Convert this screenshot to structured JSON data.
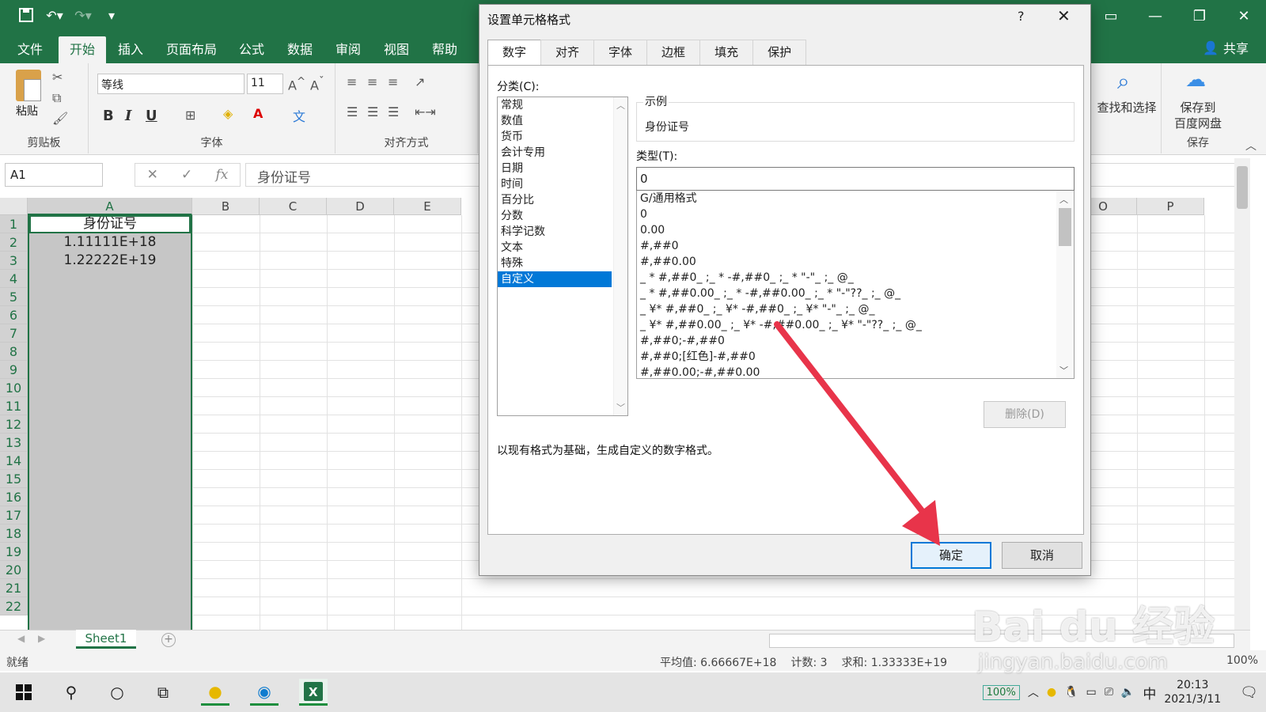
{
  "titlebar": {
    "qat": [
      "save-icon",
      "undo-icon",
      "redo-icon",
      "customize-icon"
    ],
    "accent": "#217346"
  },
  "ribbon_tabs": [
    "文件",
    "开始",
    "插入",
    "页面布局",
    "公式",
    "数据",
    "审阅",
    "视图",
    "帮助"
  ],
  "active_tab": "开始",
  "share_label": "共享",
  "ribbon": {
    "paste_label": "粘贴",
    "clipboard_label": "剪贴板",
    "font_name": "等线",
    "font_size": "11",
    "font_group_label": "字体",
    "align_group_label": "对齐方式",
    "bold": "B",
    "italic": "I",
    "underline": "U",
    "find_label": "查找和选择",
    "save_baidu_label_1": "保存到",
    "save_baidu_label_2": "百度网盘",
    "save_group_label": "保存"
  },
  "formula_bar": {
    "name_box": "A1",
    "fx": "fx",
    "content": "身份证号"
  },
  "grid": {
    "columns": [
      "A",
      "B",
      "C",
      "D",
      "E",
      "O",
      "P"
    ],
    "rows": [
      "1",
      "2",
      "3",
      "4",
      "5",
      "6",
      "7",
      "8",
      "9",
      "10",
      "11",
      "12",
      "13",
      "14",
      "15",
      "16",
      "17",
      "18",
      "19",
      "20",
      "21",
      "22"
    ],
    "cells_A": [
      "身份证号",
      "1.11111E+18",
      "1.22222E+19"
    ]
  },
  "sheet_tab": "Sheet1",
  "status": {
    "ready": "就绪",
    "average": "平均值: 6.66667E+18",
    "count": "计数: 3",
    "sum": "求和: 1.33333E+19",
    "zoom": "100%"
  },
  "dialog": {
    "title": "设置单元格格式",
    "help": "?",
    "close": "✕",
    "tabs": [
      "数字",
      "对齐",
      "字体",
      "边框",
      "填充",
      "保护"
    ],
    "active_tab": "数字",
    "category_label": "分类(C):",
    "categories": [
      "常规",
      "数值",
      "货币",
      "会计专用",
      "日期",
      "时间",
      "百分比",
      "分数",
      "科学记数",
      "文本",
      "特殊",
      "自定义"
    ],
    "selected_category": "自定义",
    "sample_label": "示例",
    "sample_value": "身份证号",
    "type_label": "类型(T):",
    "type_value": "0",
    "formats": [
      "G/通用格式",
      "0",
      "0.00",
      "#,##0",
      "#,##0.00",
      "_ * #,##0_ ;_ * -#,##0_ ;_ * \"-\"_ ;_ @_",
      "_ * #,##0.00_ ;_ * -#,##0.00_ ;_ * \"-\"??_ ;_ @_",
      "_ ¥* #,##0_ ;_ ¥* -#,##0_ ;_ ¥* \"-\"_ ;_ @_",
      "_ ¥* #,##0.00_ ;_ ¥* -#,##0.00_ ;_ ¥* \"-\"??_ ;_ @_",
      "#,##0;-#,##0",
      "#,##0;[红色]-#,##0",
      "#,##0.00;-#,##0.00"
    ],
    "delete_label": "删除(D)",
    "description": "以现有格式为基础，生成自定义的数字格式。",
    "ok_label": "确定",
    "cancel_label": "取消"
  },
  "taskbar": {
    "battery": "100%",
    "ime": "中",
    "time": "20:13",
    "date": "2021/3/11"
  },
  "watermark": {
    "main": "Bai du 经验",
    "sub": "jingyan.baidu.com"
  },
  "colors": {
    "excel_green": "#217346",
    "arrow_red": "#e8344a",
    "selection_blue": "#0078d7"
  }
}
